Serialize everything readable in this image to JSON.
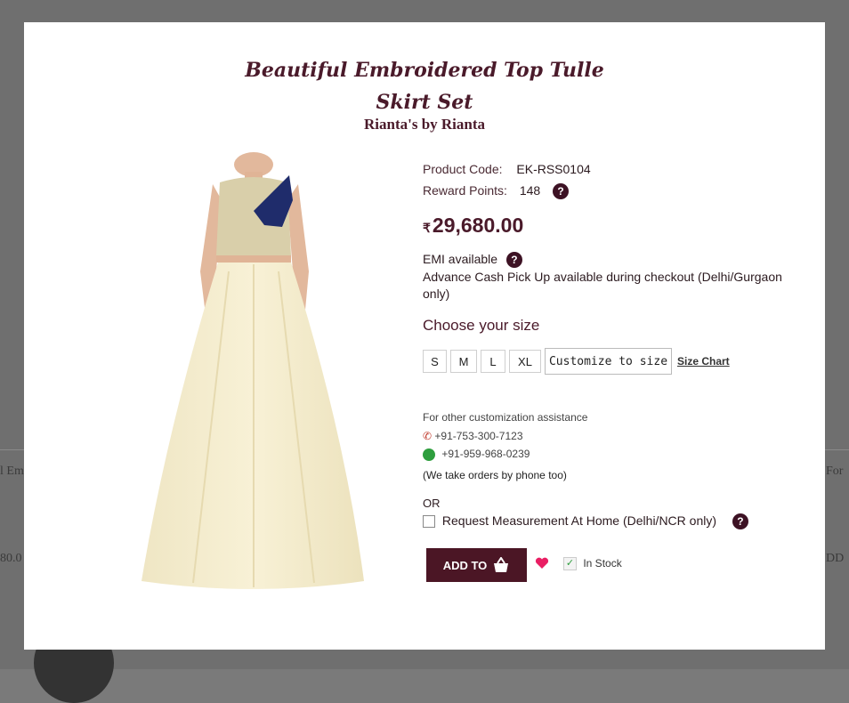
{
  "background": {
    "left_text_1": "l Em",
    "left_text_2": "80.0",
    "right_text_1": "For",
    "right_text_2": "DD"
  },
  "modal": {
    "title_line1": "Beautiful Embroidered Top Tulle",
    "title_line2": "Skirt Set",
    "brand": "Rianta's by Rianta"
  },
  "product": {
    "code_label": "Product Code:",
    "code_value": "EK-RSS0104",
    "reward_label": "Reward Points:",
    "reward_value": "148",
    "help_glyph": "?",
    "currency_symbol": "₹",
    "price": "29,680.00",
    "emi_label": "EMI available",
    "advance_text": "Advance Cash Pick Up available during checkout (Delhi/Gurgaon only)",
    "choose_size_label": "Choose your size",
    "sizes": [
      "S",
      "M",
      "L",
      "XL"
    ],
    "customize_label": "Customize to size",
    "size_chart_label": "Size Chart",
    "assistance_text": "For other customization assistance",
    "phone": "+91-753-300-7123",
    "whatsapp": "+91-959-968-0239",
    "phone_note": "(We take orders by phone too)",
    "or_label": "OR",
    "measurement_label": "Request Measurement At Home (Delhi/NCR only)",
    "add_to_label": "ADD TO",
    "stock_label": "In Stock"
  },
  "colors": {
    "brand": "#4b1625",
    "wishlist": "#e91e63",
    "whatsapp": "#2e9e3e",
    "phone": "#c0392b"
  },
  "icons": {
    "help": "question-icon",
    "cart": "basket-icon",
    "wishlist": "heart-icon",
    "phone": "phone-icon",
    "whatsapp": "whatsapp-icon",
    "stock": "check-icon"
  }
}
